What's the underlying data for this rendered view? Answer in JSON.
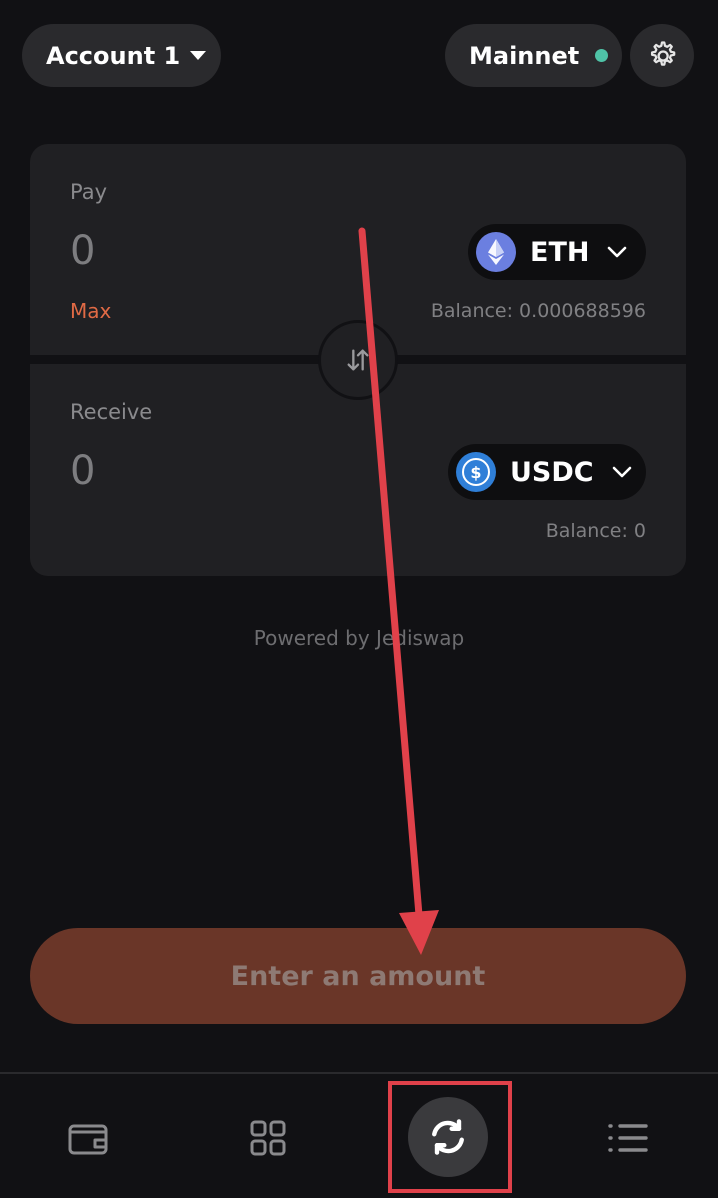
{
  "header": {
    "account_label": "Account 1",
    "network_label": "Mainnet",
    "network_status_color": "#4fc3a7"
  },
  "swap": {
    "pay": {
      "label": "Pay",
      "amount": "0",
      "max_label": "Max",
      "token": "ETH",
      "token_icon": "ethereum-icon",
      "balance": "Balance: 0.000688596"
    },
    "receive": {
      "label": "Receive",
      "amount": "0",
      "token": "USDC",
      "token_icon": "usdc-icon",
      "balance": "Balance: 0"
    },
    "powered_by": "Powered by Jediswap"
  },
  "cta": {
    "label": "Enter an amount"
  },
  "bottom_nav": {
    "items": [
      {
        "name": "wallet",
        "icon": "wallet-icon"
      },
      {
        "name": "apps",
        "icon": "grid-icon"
      },
      {
        "name": "swap",
        "icon": "swap-icon",
        "active": true
      },
      {
        "name": "activity",
        "icon": "list-icon"
      }
    ]
  },
  "annotations": {
    "arrow_color": "#e0414a",
    "highlight_color": "#e0414a"
  }
}
